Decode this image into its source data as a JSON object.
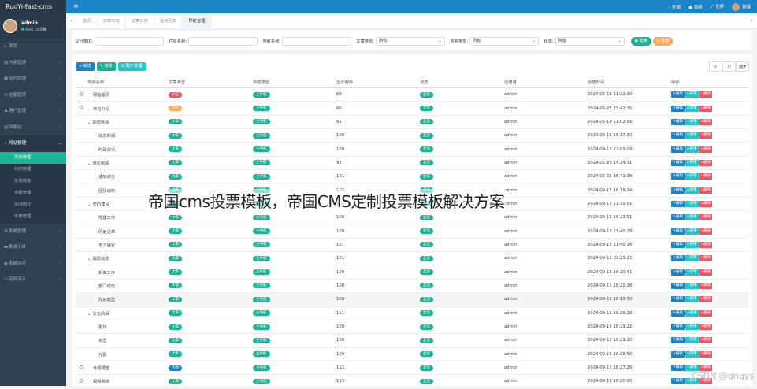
{
  "app": {
    "logo": "RuoYi-fast-cms"
  },
  "user": {
    "name": "admin",
    "status": "在线",
    "logout": "注销"
  },
  "sidebar": {
    "items": [
      {
        "label": "首页",
        "icon": "home-icon",
        "glyph": "⌂",
        "chev": ""
      },
      {
        "label": "内容管理",
        "icon": "content-icon",
        "glyph": "▤",
        "chev": "‹"
      },
      {
        "label": "专栏管理",
        "icon": "column-icon",
        "glyph": "▦",
        "chev": "‹"
      },
      {
        "label": "信箱管理",
        "icon": "mail-icon",
        "glyph": "✉",
        "chev": "‹"
      },
      {
        "label": "用户管理",
        "icon": "users-icon",
        "glyph": "♟",
        "chev": "‹"
      },
      {
        "label": "回收站",
        "icon": "trash-icon",
        "glyph": "▥",
        "chev": "‹"
      },
      {
        "label": "网站管理",
        "icon": "code-icon",
        "glyph": "‹›",
        "chev": "⌄"
      }
    ],
    "subitems": [
      "导航管理",
      "幻灯管理",
      "友情链接",
      "专题管理",
      "访问统计",
      "字典管理"
    ],
    "items2": [
      {
        "label": "系统管理",
        "icon": "gear-icon",
        "glyph": "⚙",
        "chev": "‹"
      },
      {
        "label": "系统工具",
        "icon": "tools-icon",
        "glyph": "▬",
        "chev": "‹"
      },
      {
        "label": "系统监控",
        "icon": "monitor-icon",
        "glyph": "◉",
        "chev": "‹"
      },
      {
        "label": "实例演示",
        "icon": "demo-icon",
        "glyph": "▭",
        "chev": "‹"
      }
    ]
  },
  "topbar": {
    "menu_icon": "≡",
    "kaifa": "开源",
    "suoping": "锁屏",
    "quanping": "全屏",
    "user": "管理"
  },
  "tabs": [
    "首页",
    "文章内容",
    "文章分类",
    "留言回复",
    "导航管理"
  ],
  "tab_arrows": {
    "left": "«",
    "right": "»"
  },
  "search": {
    "parent_label": "父分类ID:",
    "parent_value": "",
    "name_label": "栏目名称:",
    "name_value": "",
    "nav_label": "导航名称:",
    "nav_value": "",
    "article_type_label": "文章类型:",
    "article_type_value": "所有",
    "nav_type_label": "导航类型:",
    "nav_type_value": "所有",
    "status_label": "状态:",
    "status_value": "所有",
    "search_btn": "◉ 搜索",
    "reset_btn": "↻ 重置"
  },
  "toolbar": {
    "add": "+ 新增",
    "edit": "✎ 修改",
    "expand": "⇅ 展开/折叠"
  },
  "toolbar_icons": {
    "search": "⌕",
    "refresh": "↻",
    "columns": "▤▾"
  },
  "table": {
    "headers": [
      "导航名称",
      "文章类型",
      "导航类型",
      "显示顺序",
      "状态",
      "创建者",
      "创建时间",
      "操作"
    ],
    "rows": [
      {
        "name": "网站首页",
        "indent": 1,
        "arrow": "",
        "type": "外链",
        "typec": "#ed5565",
        "nav": "主导航",
        "order": "88",
        "status": "显示",
        "creator": "admin",
        "time": "2024-05-19 11:31:30"
      },
      {
        "name": "单位介绍",
        "indent": 1,
        "arrow": "",
        "type": "单页",
        "typec": "#f8ac59",
        "nav": "主导航",
        "order": "90",
        "status": "显示",
        "creator": "admin",
        "time": "2024-05-25 15:42:35"
      },
      {
        "name": "动态新闻",
        "indent": 0,
        "arrow": "⌄",
        "type": "文章",
        "typec": "#1ab394",
        "nav": "主导航",
        "order": "91",
        "status": "显示",
        "creator": "admin",
        "time": "2024-05-19 11:02:59"
      },
      {
        "name": "动态新闻",
        "indent": 2,
        "arrow": "",
        "type": "文章",
        "typec": "#1ab394",
        "nav": "主导航",
        "order": "100",
        "status": "显示",
        "creator": "admin",
        "time": "2024-09-15 16:17:30"
      },
      {
        "name": "时政资讯",
        "indent": 2,
        "arrow": "",
        "type": "文章",
        "typec": "#1ab394",
        "nav": "主导航",
        "order": "100",
        "status": "显示",
        "creator": "admin",
        "time": "2024-09-15 12:09:09"
      },
      {
        "name": "单位新闻",
        "indent": 0,
        "arrow": "⌄",
        "type": "文章",
        "typec": "#1ab394",
        "nav": "主导航",
        "order": "92",
        "status": "显示",
        "creator": "admin",
        "time": "2024-05-20 14:24:31"
      },
      {
        "name": "通知通告",
        "indent": 2,
        "arrow": "",
        "type": "文章",
        "typec": "#1ab394",
        "nav": "主导航",
        "order": "101",
        "status": "显示",
        "creator": "admin",
        "time": "2024-05-25 15:41:38"
      },
      {
        "name": "团队动态",
        "indent": 2,
        "arrow": "",
        "type": "文章",
        "typec": "#1ab394",
        "nav": "主导航",
        "order": "100",
        "status": "显示",
        "creator": "admin",
        "time": "2024-09-15 16:18:34"
      },
      {
        "name": "党的建设",
        "indent": 0,
        "arrow": "⌄",
        "type": "文章",
        "typec": "#1ab394",
        "nav": "主导航",
        "order": "100",
        "status": "显示",
        "creator": "admin",
        "time": "2024-09-15 11:39:51"
      },
      {
        "name": "党建工作",
        "indent": 2,
        "arrow": "",
        "type": "文章",
        "typec": "#1ab394",
        "nav": "主导航",
        "order": "100",
        "status": "显示",
        "creator": "admin",
        "time": "2024-09-15 16:23:51"
      },
      {
        "name": "历史沿革",
        "indent": 2,
        "arrow": "",
        "type": "文章",
        "typec": "#1ab394",
        "nav": "主导航",
        "order": "100",
        "status": "显示",
        "creator": "admin",
        "time": "2024-09-15 11:40:29"
      },
      {
        "name": "学习强省",
        "indent": 2,
        "arrow": "",
        "type": "文章",
        "typec": "#1ab394",
        "nav": "主导航",
        "order": "101",
        "status": "显示",
        "creator": "admin",
        "time": "2024-09-15 11:40:14"
      },
      {
        "name": "基层动态",
        "indent": 0,
        "arrow": "⌄",
        "type": "文章",
        "typec": "#1ab394",
        "nav": "主导航",
        "order": "101",
        "status": "显示",
        "creator": "admin",
        "time": "2024-09-15 09:25:23"
      },
      {
        "name": "机关工作",
        "indent": 2,
        "arrow": "",
        "type": "文章",
        "typec": "#1ab394",
        "nav": "主导航",
        "order": "100",
        "status": "显示",
        "creator": "admin",
        "time": "2024-09-15 16:20:41"
      },
      {
        "name": "部门动态",
        "indent": 2,
        "arrow": "",
        "type": "文章",
        "typec": "#1ab394",
        "nav": "主导航",
        "order": "100",
        "status": "显示",
        "creator": "admin",
        "time": "2024-09-15 16:20:18"
      },
      {
        "name": "先进典型",
        "indent": 2,
        "arrow": "",
        "type": "文章",
        "typec": "#1ab394",
        "nav": "主导航",
        "order": "100",
        "status": "显示",
        "creator": "admin",
        "time": "2024-09-15 16:19:59"
      },
      {
        "name": "文化风采",
        "indent": 0,
        "arrow": "⌄",
        "type": "文章",
        "typec": "#1ab394",
        "nav": "主导航",
        "order": "111",
        "status": "显示",
        "creator": "admin",
        "time": "2024-09-15 16:29:28"
      },
      {
        "name": "报刊",
        "indent": 2,
        "arrow": "",
        "type": "文章",
        "typec": "#1ab394",
        "nav": "主导航",
        "order": "100",
        "status": "显示",
        "creator": "admin",
        "time": "2024-09-15 16:29:22"
      },
      {
        "name": "杂志",
        "indent": 2,
        "arrow": "",
        "type": "文章",
        "typec": "#1ab394",
        "nav": "主导航",
        "order": "100",
        "status": "显示",
        "creator": "admin",
        "time": "2024-09-15 16:29:10"
      },
      {
        "name": "光影",
        "indent": 2,
        "arrow": "",
        "type": "文章",
        "typec": "#1ab394",
        "nav": "主导航",
        "order": "100",
        "status": "显示",
        "creator": "admin",
        "time": "2024-09-15 16:28:58"
      },
      {
        "name": "专题课堂",
        "indent": 1,
        "arrow": "",
        "type": "专题",
        "typec": "#1c84c6",
        "nav": "主导航",
        "order": "112",
        "status": "显示",
        "creator": "admin",
        "time": "2024-09-15 16:27:29"
      },
      {
        "name": "视频频道",
        "indent": 1,
        "arrow": "",
        "type": "文章",
        "typec": "#1ab394",
        "nav": "主导航",
        "order": "113",
        "status": "显示",
        "creator": "admin",
        "time": "2024-09-15 16:20:00"
      }
    ],
    "actions": {
      "edit": "✎编辑",
      "add": "+新增",
      "delete": "×删除"
    }
  },
  "overlay": {
    "caption": "帝国cms投票模板，帝国CMS定制投票模板解决方案",
    "watermark": "CSDN @qnqys"
  },
  "colors": {
    "sidebar": "#2f4050",
    "topbar": "#1c84c6",
    "green": "#1ab394",
    "blue": "#1c84c6",
    "cyan": "#23c6c8",
    "red": "#ed5565",
    "orange": "#f8ac59"
  }
}
